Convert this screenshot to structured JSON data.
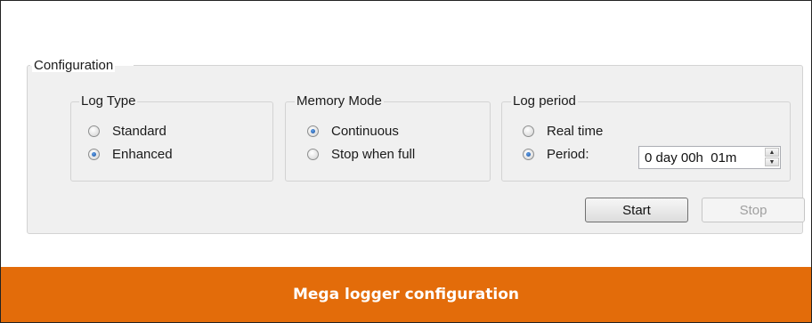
{
  "configuration": {
    "title": "Configuration",
    "log_type": {
      "title": "Log Type",
      "options": [
        {
          "label": "Standard",
          "checked": false
        },
        {
          "label": "Enhanced",
          "checked": true
        }
      ]
    },
    "memory_mode": {
      "title": "Memory Mode",
      "options": [
        {
          "label": "Continuous",
          "checked": true
        },
        {
          "label": "Stop when full",
          "checked": false
        }
      ]
    },
    "log_period": {
      "title": "Log period",
      "options": [
        {
          "label": "Real time",
          "checked": false
        },
        {
          "label": "Period:",
          "checked": true
        }
      ],
      "period_value": "0 day 00h  01m"
    },
    "buttons": {
      "start_label": "Start",
      "stop_label": "Stop",
      "stop_enabled": false
    }
  },
  "caption": "Mega logger configuration",
  "colors": {
    "caption_bg": "#e36c0a",
    "caption_text": "#ffffff",
    "panel_bg": "#f0f0f0",
    "radio_dot": "#1b4f9c"
  }
}
